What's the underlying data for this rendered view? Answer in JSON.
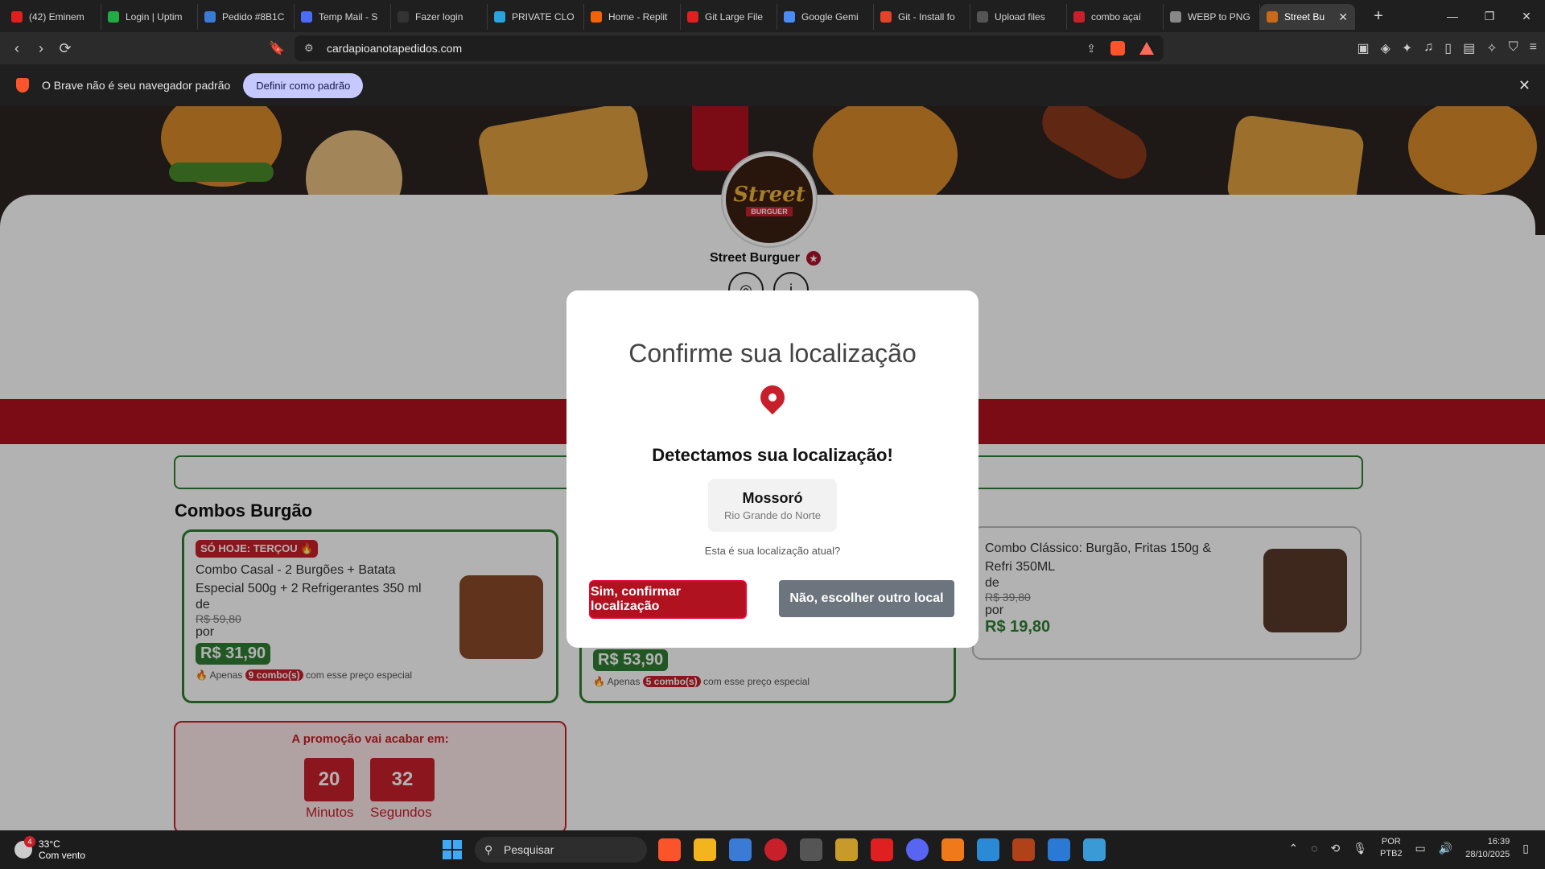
{
  "browser": {
    "tabs": [
      {
        "label": "(42) Eminem",
        "color": "#e02020"
      },
      {
        "label": "Login | Uptim",
        "color": "#22aa44"
      },
      {
        "label": "Pedido #8B1C",
        "color": "#3a7bd5"
      },
      {
        "label": "Temp Mail - S",
        "color": "#4a6cf7"
      },
      {
        "label": "Fazer login",
        "color": "#333333"
      },
      {
        "label": "PRIVATE CLO",
        "color": "#2aa3e0"
      },
      {
        "label": "Home - Replit",
        "color": "#f26207"
      },
      {
        "label": "Git Large File",
        "color": "#e02020"
      },
      {
        "label": "Google Gemi",
        "color": "#4a8cf7"
      },
      {
        "label": "Git - Install fo",
        "color": "#e24329"
      },
      {
        "label": "Upload files",
        "color": "#555555"
      },
      {
        "label": "combo açaí",
        "color": "#c8202a"
      },
      {
        "label": "WEBP to PNG",
        "color": "#888888"
      },
      {
        "label": "Street Bu",
        "color": "#c86a1a"
      }
    ],
    "url": "cardapioanotapedidos.com",
    "infobar_text": "O Brave não é seu navegador padrão",
    "infobar_button": "Definir como padrão"
  },
  "store": {
    "name": "Street Burguer",
    "logo_text": "Street",
    "logo_sub": "BURGUER"
  },
  "section_title": "Combos Burgão",
  "combos": [
    {
      "badge": "SÓ HOJE: TERÇOU 🔥",
      "name": "Combo Casal - 2 Burgões + Batata Especial 500g + 2 Refrigerantes 350 ml",
      "from_label": "de",
      "old_price": "R$ 59,80",
      "by_label": "por",
      "new_price": "R$ 31,90",
      "note_prefix": "🔥 Apenas",
      "note_count": "9 combo(s)",
      "note_suffix": "com esse preço especial"
    },
    {
      "new_price": "R$ 53,90",
      "note_prefix": "🔥 Apenas",
      "note_count": "5 combo(s)",
      "note_suffix": "com esse preço especial"
    },
    {
      "name": "Combo Clássico: Burgão, Fritas 150g & Refri 350ML",
      "from_label": "de",
      "old_price": "R$ 39,80",
      "by_label": "por",
      "new_price": "R$ 19,80"
    }
  ],
  "promo": {
    "title": "A promoção vai acabar em:",
    "minutes": "20",
    "minutes_label": "Minutos",
    "seconds": "32",
    "seconds_label": "Segundos"
  },
  "modal": {
    "title": "Confirme sua localização",
    "detected": "Detectamos sua localização!",
    "city": "Mossoró",
    "state": "Rio Grande do Norte",
    "question": "Esta é sua localização atual?",
    "confirm_button": "Sim, confirmar localização",
    "other_button": "Não, escolher outro local"
  },
  "taskbar": {
    "temperature": "33°C",
    "weather": "Com vento",
    "weather_badge": "4",
    "search_placeholder": "Pesquisar",
    "lang_top": "POR",
    "lang_bottom": "PTB2",
    "time": "16:39",
    "date": "28/10/2025"
  }
}
